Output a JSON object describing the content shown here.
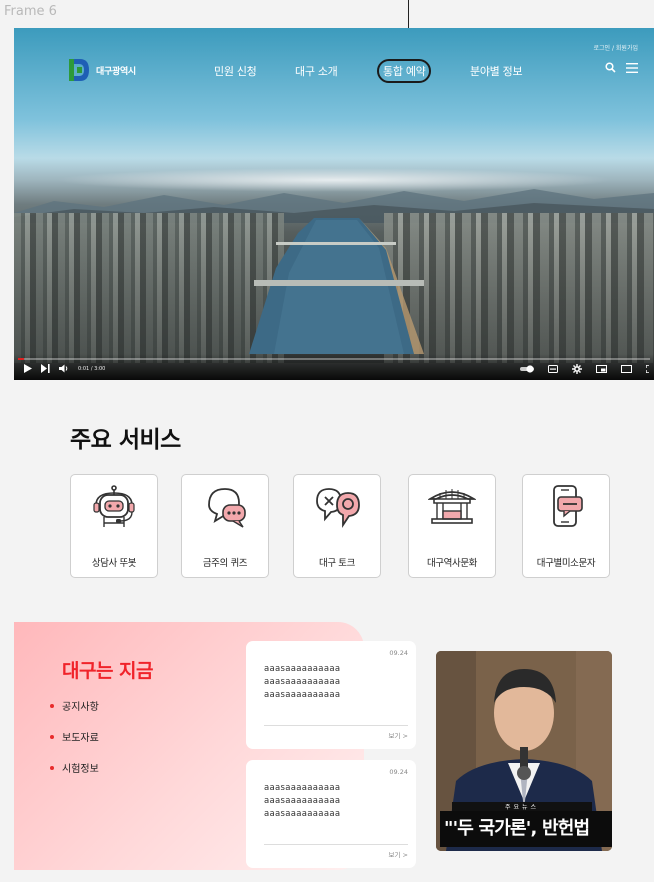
{
  "frame_label": "Frame 6",
  "hero": {
    "top_links": "로그인 / 회원가입",
    "logo_text": "대구광역시",
    "nav": [
      {
        "label": "민원 신청"
      },
      {
        "label": "대구 소개"
      },
      {
        "label": "통합 예약",
        "highlighted": true
      },
      {
        "label": "분야별 정보"
      }
    ],
    "player": {
      "time": "0:01 / 3:00",
      "progress_fraction": 0.01
    }
  },
  "services": {
    "title": "주요 서비스",
    "items": [
      {
        "label": "상담사 뚜봇",
        "icon": "robot-headset-icon"
      },
      {
        "label": "금주의 퀴즈",
        "icon": "chat-bubbles-icon"
      },
      {
        "label": "대구 토크",
        "icon": "talk-bubbles-icon"
      },
      {
        "label": "대구역사문화",
        "icon": "pavilion-icon"
      },
      {
        "label": "대구별미소문자",
        "icon": "phone-message-icon"
      }
    ]
  },
  "now": {
    "title": "대구는 지금",
    "items": [
      "공지사항",
      "보도자료",
      "시험정보"
    ],
    "cards": [
      {
        "date": "09.24",
        "lines": [
          "aaasaaaaaaaaaa",
          "aaasaaaaaaaaaa",
          "aaasaaaaaaaaaa"
        ],
        "more": "보기 >"
      },
      {
        "date": "09.24",
        "lines": [
          "aaasaaaaaaaaaa",
          "aaasaaaaaaaaaa",
          "aaasaaaaaaaaaa"
        ],
        "more": "보기 >"
      }
    ]
  },
  "news_photo": {
    "tag": "주요뉴스",
    "caption": "\"'두 국가론', 반헌법"
  },
  "colors": {
    "accent_red": "#f0232a",
    "progress_red": "#e02020"
  }
}
